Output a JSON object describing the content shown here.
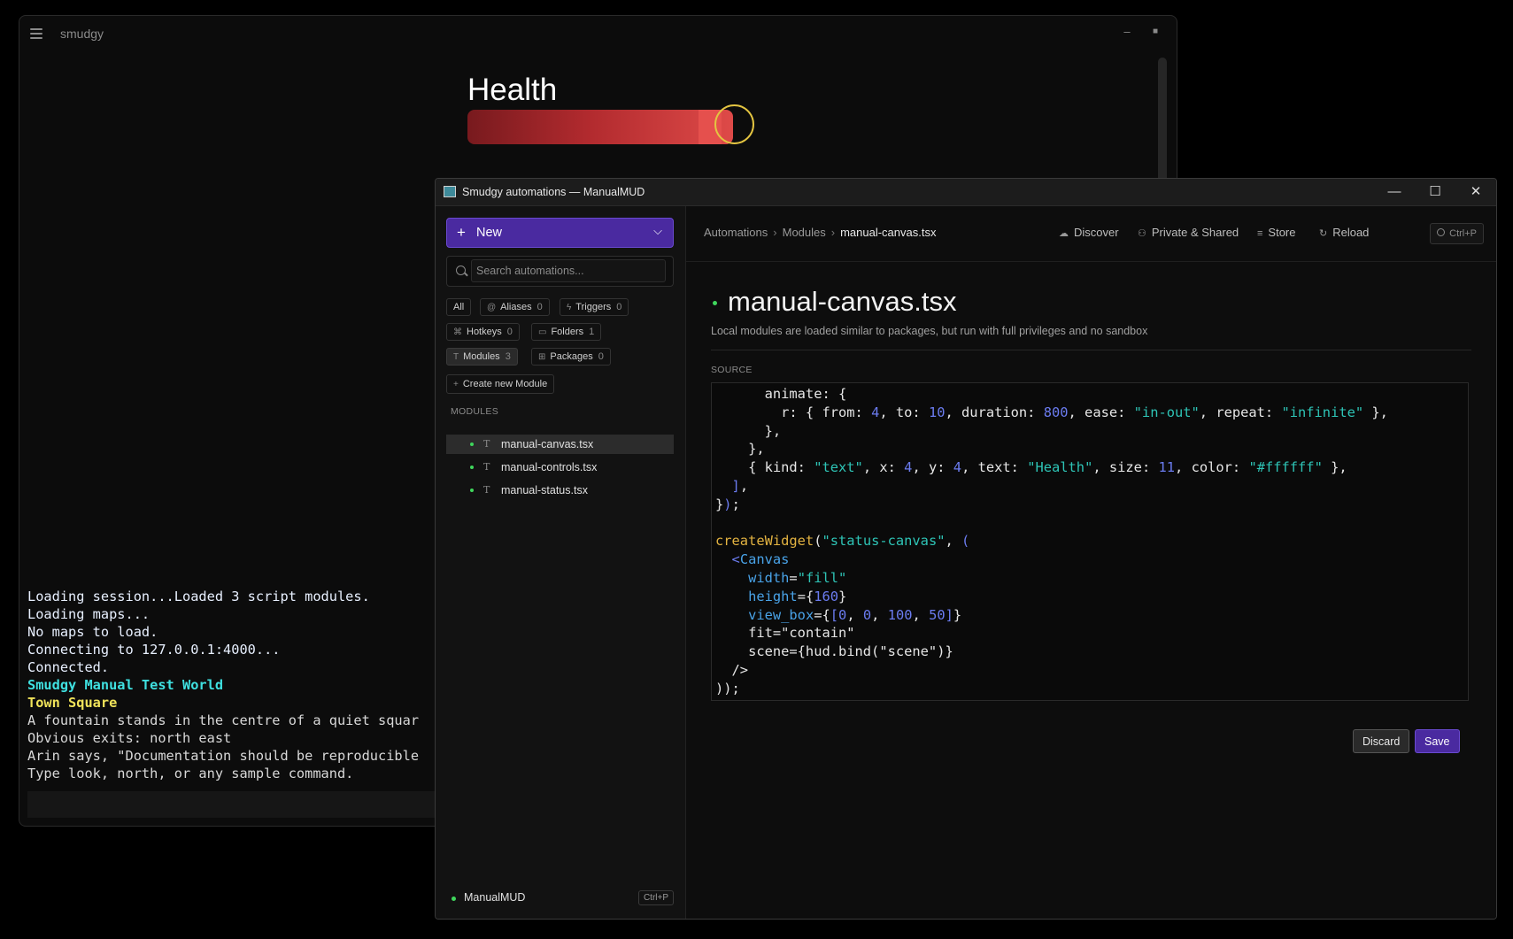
{
  "bg_window": {
    "title": "smudgy",
    "controls": {
      "minimize": "–",
      "maximize": "■",
      "close": "✕"
    },
    "health_label": "Health",
    "health_fill_fraction": 1.0,
    "terminal_lines": [
      "Loading session...Loaded 3 script modules.",
      "Loading maps...",
      "No maps to load.",
      "Connecting to 127.0.0.1:4000...",
      "Connected.",
      "Smudgy Manual Test World",
      "Town Square",
      "A fountain stands in the centre of a quiet squar",
      "Obvious exits: north east",
      "Arin says, \"Documentation should be reproducible",
      "Type look, north, or any sample command."
    ]
  },
  "automations_window": {
    "title": "Smudgy automations — ManualMUD",
    "controls": {
      "minimize": "—",
      "maximize": "☐",
      "close": "✕"
    },
    "sidebar": {
      "new_button": {
        "icon": "+",
        "label": "New",
        "chevron": "⌵"
      },
      "search_placeholder": "Search automations...",
      "filters": [
        {
          "label": "All",
          "icon": "",
          "count": ""
        },
        {
          "label": "Aliases",
          "icon": "@",
          "count": "0"
        },
        {
          "label": "Triggers",
          "icon": "ϟ",
          "count": "0"
        },
        {
          "label": "Hotkeys",
          "icon": "⌘",
          "count": "0"
        },
        {
          "label": "Folders",
          "icon": "▭",
          "count": "1"
        },
        {
          "label": "Modules",
          "icon": "T",
          "count": "3"
        },
        {
          "label": "Packages",
          "icon": "⊞",
          "count": "0"
        }
      ],
      "create_button": {
        "icon": "+",
        "label": "Create new Module"
      },
      "modules_heading": "MODULES",
      "modules": [
        {
          "icon": "T",
          "name": "manual-canvas.tsx"
        },
        {
          "icon": "T",
          "name": "manual-controls.tsx"
        },
        {
          "icon": "T",
          "name": "manual-status.tsx"
        }
      ],
      "footer": {
        "session": "ManualMUD",
        "shortcut": "Ctrl+P"
      }
    },
    "header": {
      "breadcrumb": [
        "Automations",
        "Modules",
        "manual-canvas.tsx"
      ],
      "breadcrumb_sep": "›",
      "links": [
        {
          "icon": "☁",
          "label": "Discover"
        },
        {
          "icon": "⚇",
          "label": "Private & Shared"
        },
        {
          "icon": "≡",
          "label": "Store"
        },
        {
          "icon": "↻",
          "label": "Reload"
        }
      ],
      "quick_open": "Ctrl+P"
    },
    "module": {
      "title": "manual-canvas.tsx",
      "description": "Local modules are loaded similar to packages, but run with full privileges and no sandbox",
      "source_label": "SOURCE"
    },
    "actions": {
      "discard": "Discard",
      "save": "Save"
    }
  },
  "colors": {
    "accent_purple": "#4a2aa0",
    "status_green": "#3fd65c",
    "health_red": "#de4a48",
    "cursor_ring": "#e3c441"
  }
}
